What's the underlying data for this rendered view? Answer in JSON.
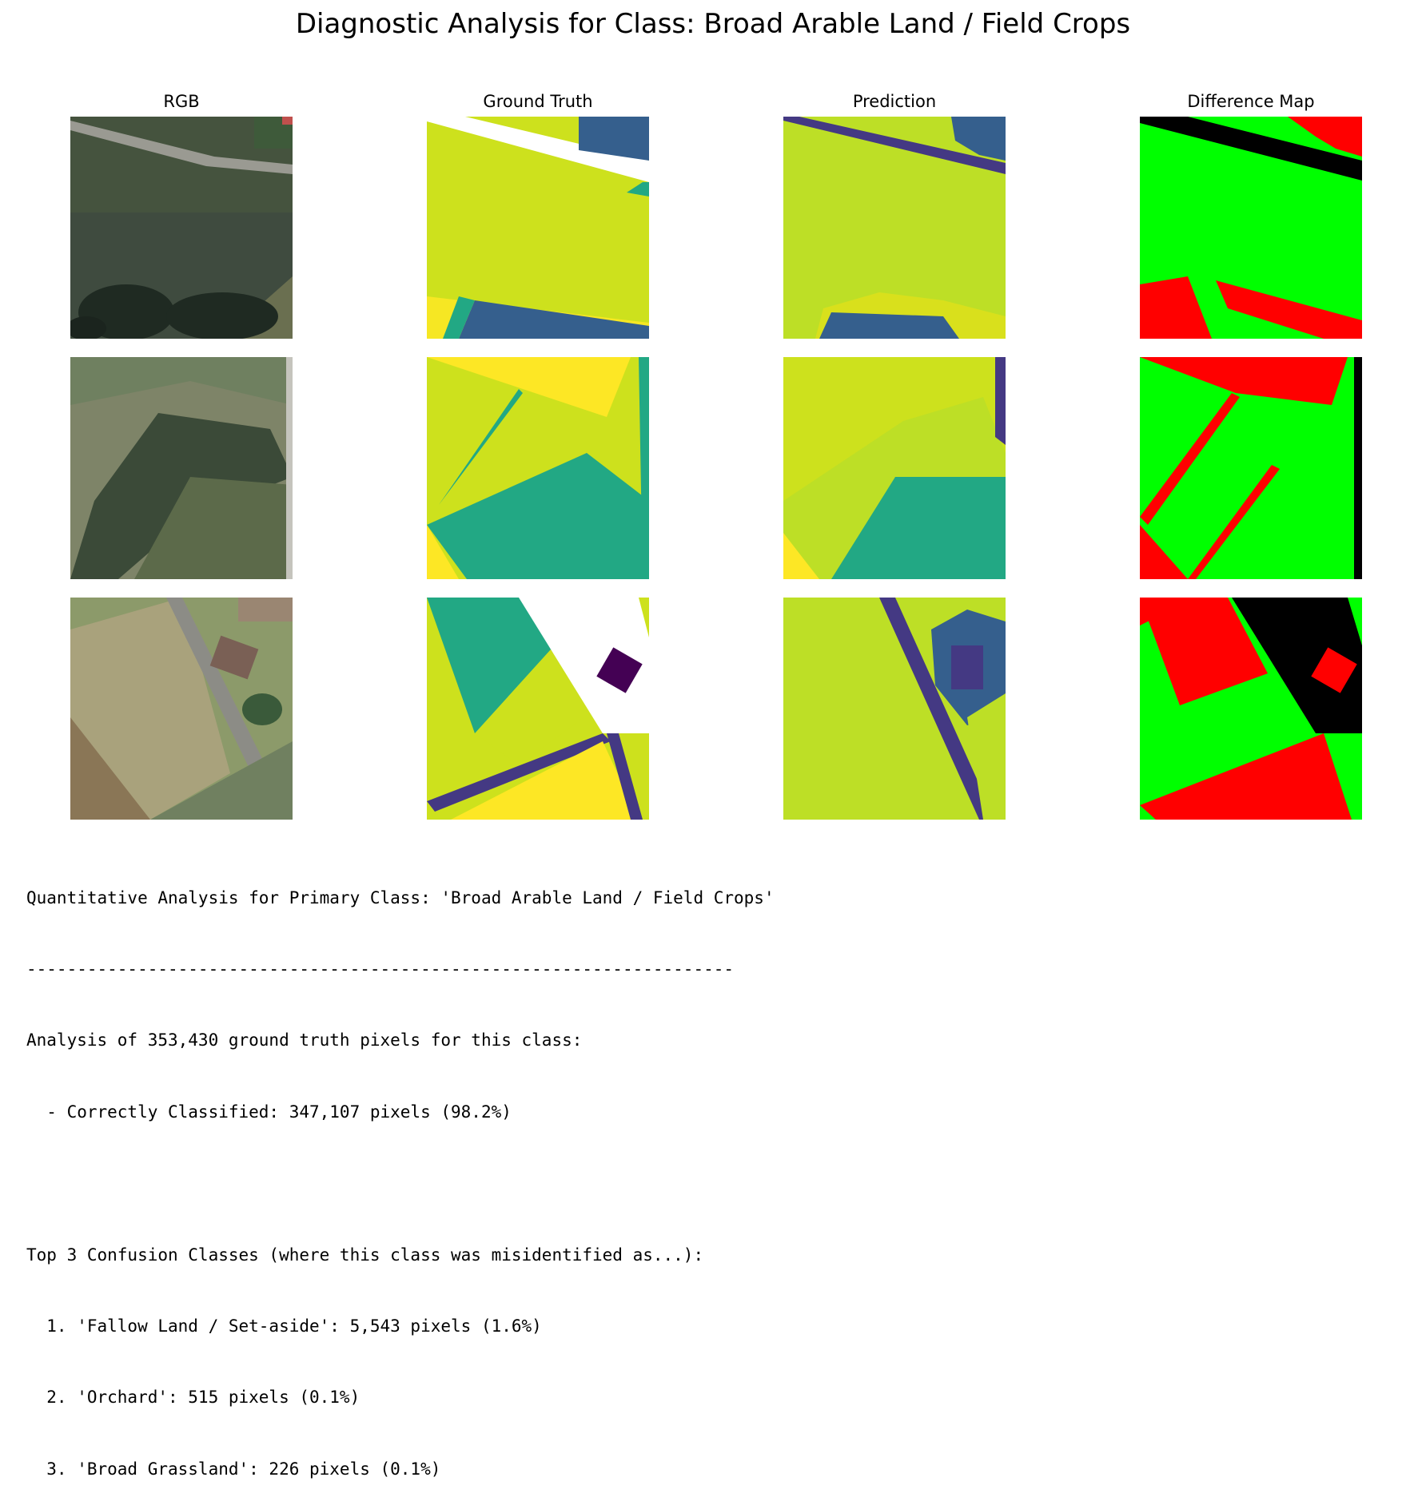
{
  "title": "Diagnostic Analysis for Class: Broad Arable Land / Field Crops",
  "columns": [
    "RGB",
    "Ground Truth",
    "Prediction",
    "Difference Map"
  ],
  "colors": {
    "legend_correct": "#00ff00",
    "legend_error": "#ff0000",
    "legend_ignored": "#000000",
    "viridis_yellow_green": "#cde11d",
    "viridis_yellow": "#fde725",
    "viridis_teal": "#22a884",
    "viridis_blue": "#355f8d",
    "viridis_indigo": "#443983",
    "viridis_purple": "#440154"
  },
  "report": {
    "heading": "Quantitative Analysis for Primary Class: 'Broad Arable Land / Field Crops'",
    "separator": "----------------------------------------------------------------------",
    "summary": "Analysis of 353,430 ground truth pixels for this class:",
    "correct": "  - Correctly Classified: 347,107 pixels (98.2%)",
    "confusion_heading": "Top 3 Confusion Classes (where this class was misidentified as...):",
    "confusions": [
      "  1. 'Fallow Land / Set-aside': 5,543 pixels (1.6%)",
      "  2. 'Orchard': 515 pixels (0.1%)",
      "  3. 'Broad Grassland': 226 pixels (0.1%)"
    ]
  }
}
